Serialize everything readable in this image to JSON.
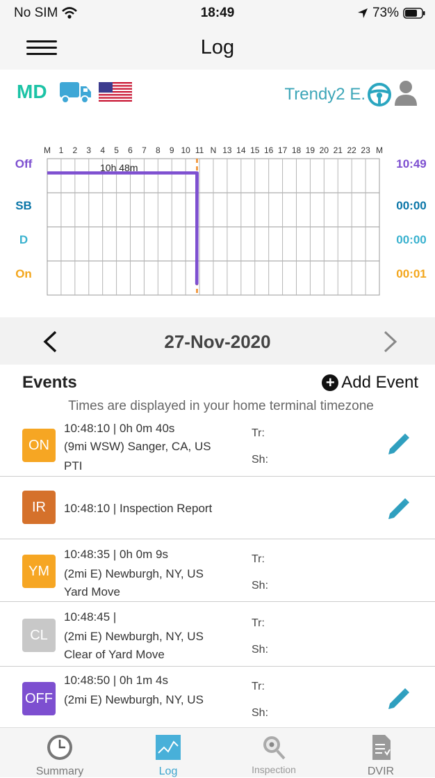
{
  "status": {
    "carrier": "No SIM",
    "time": "18:49",
    "battery": "73%"
  },
  "nav": {
    "title": "Log"
  },
  "driver": {
    "mode": "MD",
    "name": "Trendy2 E."
  },
  "chart_data": {
    "type": "line",
    "hour_labels": [
      "M",
      "1",
      "2",
      "3",
      "4",
      "5",
      "6",
      "7",
      "8",
      "9",
      "10",
      "11",
      "N",
      "13",
      "14",
      "15",
      "16",
      "17",
      "18",
      "19",
      "20",
      "21",
      "22",
      "23",
      "M"
    ],
    "rows": [
      {
        "label": "Off",
        "total": "10:49",
        "color": "#7d4fd0"
      },
      {
        "label": "SB",
        "total": "00:00",
        "color": "#0b76a8"
      },
      {
        "label": "D",
        "total": "00:00",
        "color": "#3ab2cf"
      },
      {
        "label": "On",
        "total": "00:01",
        "color": "#f3a61c"
      }
    ],
    "duration_label": "10h 48m",
    "segments": [
      {
        "status": "Off",
        "start_hour": 0,
        "end_hour": 10.83
      },
      {
        "status": "On",
        "start_hour": 10.8,
        "end_hour": 10.81
      },
      {
        "status": "Off",
        "start_hour": 10.81,
        "end_hour": 10.83
      }
    ],
    "current_hour": 10.82,
    "xlim": [
      0,
      24
    ]
  },
  "date": {
    "text": "27-Nov-2020"
  },
  "events": {
    "heading": "Events",
    "add_label": "Add Event",
    "tz_note": "Times are displayed in your home terminal timezone",
    "items": [
      {
        "code": "ON",
        "color": "#f6a623",
        "line1": "10:48:10 | 0h 0m 40s",
        "line2": "(9mi WSW) Sanger, CA, US",
        "line3": "PTI",
        "tr": "Tr:",
        "sh": "Sh:"
      },
      {
        "code": "IR",
        "color": "#d5712b",
        "line1": "10:48:10 | Inspection Report"
      },
      {
        "code": "YM",
        "color": "#f6a623",
        "line1": "10:48:35 | 0h 0m 9s",
        "line2": "(2mi E) Newburgh, NY, US",
        "line3": "Yard Move",
        "tr": "Tr:",
        "sh": "Sh:"
      },
      {
        "code": "CL",
        "color": "#c8c8c8",
        "line1": "10:48:45 |",
        "line2": "(2mi E) Newburgh, NY, US",
        "line3": "Clear of Yard Move",
        "tr": "Tr:",
        "sh": "Sh:"
      },
      {
        "code": "OFF",
        "color": "#7d4fd0",
        "line1": "10:48:50 | 0h 1m 4s",
        "line2": "(2mi E) Newburgh, NY, US",
        "tr": "Tr:",
        "sh": "Sh:"
      }
    ]
  },
  "tabs": [
    {
      "label": "Summary"
    },
    {
      "label": "Log"
    },
    {
      "label": "Inspection"
    },
    {
      "label": "DVIR"
    }
  ]
}
